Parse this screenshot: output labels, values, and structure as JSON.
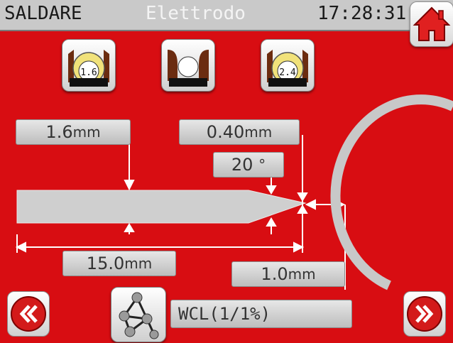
{
  "header": {
    "mode": "SALDARE",
    "title": "Elettrodo",
    "time": "17:28:31"
  },
  "presets": [
    {
      "name": "preset-1-6",
      "label": "1.6"
    },
    {
      "name": "preset-blank",
      "label": ""
    },
    {
      "name": "preset-2-4",
      "label": "2.4"
    }
  ],
  "dimensions": {
    "diameter": {
      "value": "1.6",
      "unit": "mm"
    },
    "tip": {
      "value": "0.40",
      "unit": "mm"
    },
    "angle": {
      "value": "20",
      "unit": "°"
    },
    "taper_length": {
      "value": "15.0",
      "unit": "mm"
    },
    "gap": {
      "value": "1.0",
      "unit": "mm"
    }
  },
  "electrode_type": "WCL(1/1%)",
  "colors": {
    "background": "#d80d12",
    "panel": "#c9c9c9",
    "accent_red": "#e31b1b"
  },
  "icons": {
    "home": "home-icon",
    "back": "double-chevron-left-icon",
    "forward": "double-chevron-right-icon",
    "electrode_type": "molecule-icon"
  }
}
